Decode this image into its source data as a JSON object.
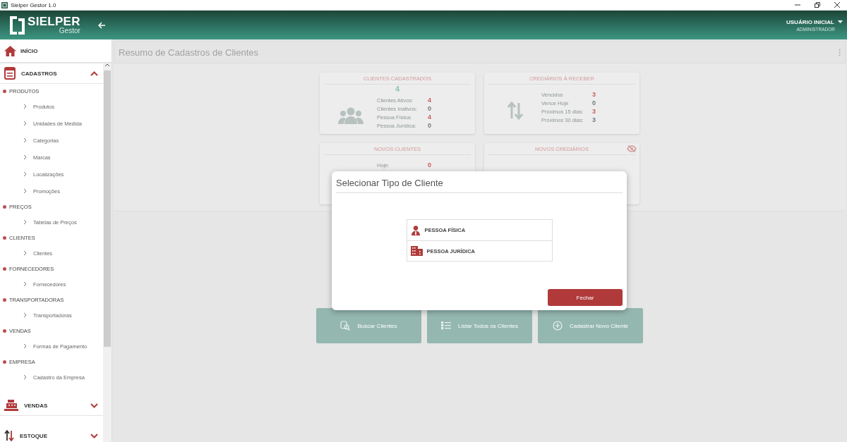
{
  "window": {
    "title": "Sielper Gestor 1.0"
  },
  "header": {
    "brand": "SIELPER",
    "product": "Gestor",
    "user": "USUÁRIO INICIAL",
    "role": "ADMINISTRADOR"
  },
  "sidebar": {
    "home": "INÍCIO",
    "sections": [
      {
        "label": "CADASTROS",
        "expanded": true,
        "groups": [
          {
            "label": "PRODUTOS",
            "items": [
              "Produtos",
              "Unidades de Medida",
              "Categorias",
              "Marcas",
              "Localizações",
              "Promoções"
            ]
          },
          {
            "label": "PREÇOS",
            "items": [
              "Tabelas de Preços"
            ]
          },
          {
            "label": "CLIENTES",
            "items": [
              "Clientes"
            ]
          },
          {
            "label": "FORNECEDORES",
            "items": [
              "Fornecedores"
            ]
          },
          {
            "label": "TRANSPORTADORAS",
            "items": [
              "Transportadoras"
            ]
          },
          {
            "label": "VENDAS",
            "items": [
              "Formas de Pagamento"
            ]
          },
          {
            "label": "EMPRESA",
            "items": [
              "Cadastro da Empresa"
            ]
          }
        ]
      },
      {
        "label": "VENDAS",
        "expanded": false
      },
      {
        "label": "ESTOQUE",
        "expanded": false
      }
    ]
  },
  "page": {
    "title": "Resumo de Cadastros de Clientes",
    "cards": [
      {
        "title": "CLIENTES CADASTRADOS",
        "total": "4",
        "values_hidden": false,
        "rows": [
          {
            "label": "Clientes Ativos:",
            "value": "4",
            "highlighted": true
          },
          {
            "label": "Clientes Inativos:",
            "value": "0",
            "highlighted": false
          },
          {
            "label": "Pessoa Física:",
            "value": "4",
            "highlighted": true
          },
          {
            "label": "Pessoa Jurídica:",
            "value": "0",
            "highlighted": false
          }
        ]
      },
      {
        "title": "CREDIÁRIOS À RECEBER",
        "values_hidden": false,
        "rows": [
          {
            "label": "Vencidos",
            "value": "3",
            "highlighted": true
          },
          {
            "label": "Vence Hoje",
            "value": "0",
            "highlighted": false
          },
          {
            "label": "Próximos 15 dias:",
            "value": "3",
            "highlighted": true
          },
          {
            "label": "Próximos 30 dias:",
            "value": "3",
            "highlighted": false
          }
        ]
      },
      {
        "title": "NOVOS CLIENTES",
        "values_hidden": false,
        "rows": [
          {
            "label": "Hoje:",
            "value": "0",
            "highlighted": true
          }
        ]
      },
      {
        "title": "NOVOS CREDIÁRIOS",
        "values_hidden": true
      }
    ],
    "actions": [
      "Buscar Clientes",
      "Listar Todos os Clientes",
      "Cadastrar Novo Cliente"
    ]
  },
  "dialog": {
    "title": "Selecionar Tipo de Cliente",
    "options": [
      "PESSOA FÍSICA",
      "PESSOA JURÍDICA"
    ],
    "close_button": "Fechar"
  }
}
